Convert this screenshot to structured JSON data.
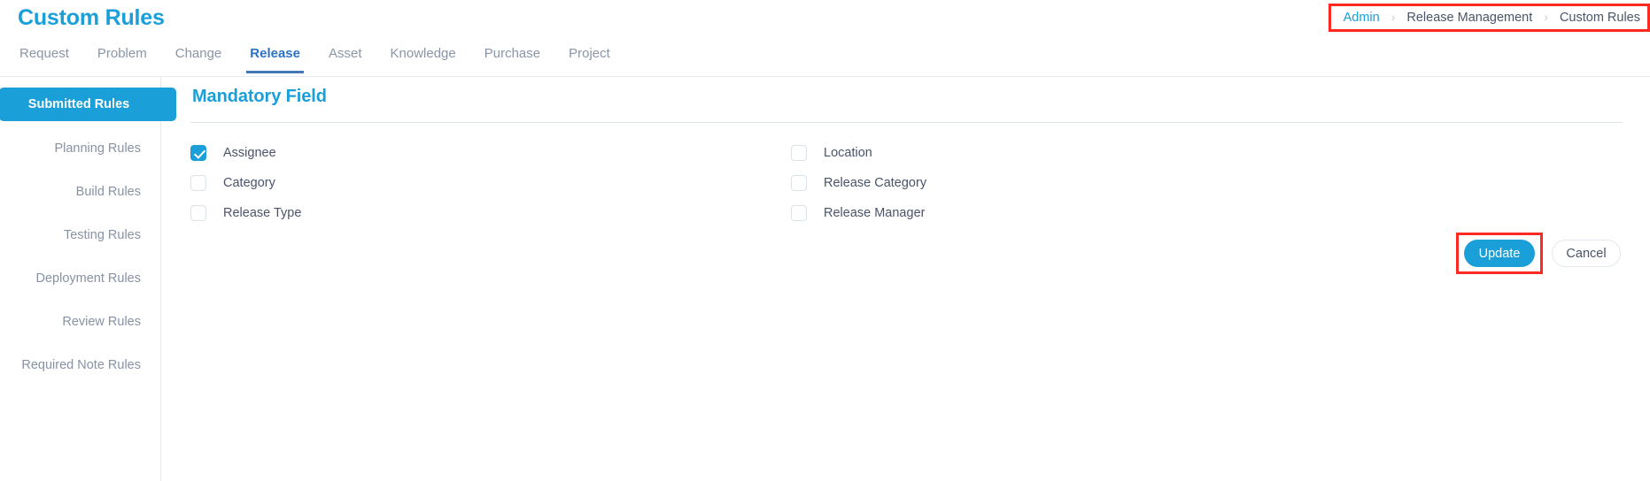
{
  "header": {
    "title": "Custom Rules",
    "breadcrumb": [
      {
        "label": "Admin",
        "is_link": true
      },
      {
        "label": "Release Management",
        "is_link": false
      },
      {
        "label": "Custom Rules",
        "is_link": false
      }
    ],
    "breadcrumb_separator": "›",
    "highlight_color": "#fb2a23",
    "accent_color": "#1b9fd8"
  },
  "tabs": [
    {
      "label": "Request",
      "active": false
    },
    {
      "label": "Problem",
      "active": false
    },
    {
      "label": "Change",
      "active": false
    },
    {
      "label": "Release",
      "active": true
    },
    {
      "label": "Asset",
      "active": false
    },
    {
      "label": "Knowledge",
      "active": false
    },
    {
      "label": "Purchase",
      "active": false
    },
    {
      "label": "Project",
      "active": false
    }
  ],
  "sidebar": {
    "items": [
      {
        "label": "Submitted Rules",
        "active": true
      },
      {
        "label": "Planning Rules",
        "active": false
      },
      {
        "label": "Build Rules",
        "active": false
      },
      {
        "label": "Testing Rules",
        "active": false
      },
      {
        "label": "Deployment Rules",
        "active": false
      },
      {
        "label": "Review Rules",
        "active": false
      },
      {
        "label": "Required Note Rules",
        "active": false
      }
    ]
  },
  "main": {
    "section_title": "Mandatory Field",
    "fields_left": [
      {
        "label": "Assignee",
        "checked": true
      },
      {
        "label": "Category",
        "checked": false
      },
      {
        "label": "Release Type",
        "checked": false
      }
    ],
    "fields_right": [
      {
        "label": "Location",
        "checked": false
      },
      {
        "label": "Release Category",
        "checked": false
      },
      {
        "label": "Release Manager",
        "checked": false
      }
    ],
    "actions": {
      "update_label": "Update",
      "cancel_label": "Cancel",
      "update_highlighted": true
    }
  }
}
